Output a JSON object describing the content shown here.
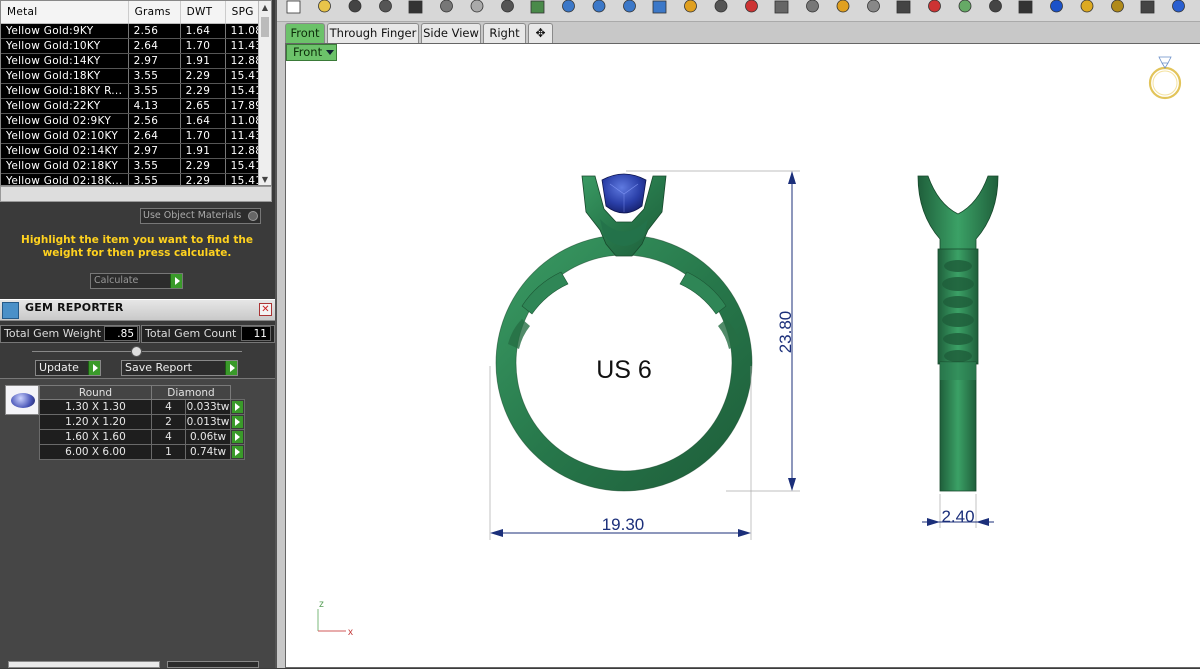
{
  "metal_table": {
    "headers": [
      "Metal",
      "Grams",
      "DWT",
      "SPG"
    ],
    "rows": [
      [
        "Yellow Gold:9KY",
        "2.56",
        "1.64",
        "11.08"
      ],
      [
        "Yellow Gold:10KY",
        "2.64",
        "1.70",
        "11.43"
      ],
      [
        "Yellow Gold:14KY",
        "2.97",
        "1.91",
        "12.88"
      ],
      [
        "Yellow Gold:18KY",
        "3.55",
        "2.29",
        "15.41"
      ],
      [
        "Yellow Gold:18KY R...",
        "3.55",
        "2.29",
        "15.41"
      ],
      [
        "Yellow Gold:22KY",
        "4.13",
        "2.65",
        "17.89"
      ],
      [
        "Yellow Gold 02:9KY",
        "2.56",
        "1.64",
        "11.08"
      ],
      [
        "Yellow Gold 02:10KY",
        "2.64",
        "1.70",
        "11.43"
      ],
      [
        "Yellow Gold 02:14KY",
        "2.97",
        "1.91",
        "12.88"
      ],
      [
        "Yellow Gold 02:18KY",
        "3.55",
        "2.29",
        "15.41"
      ],
      [
        "Yellow Gold 02:18K...",
        "3.55",
        "2.29",
        "15.41"
      ]
    ]
  },
  "metal_panel": {
    "use_object_materials": "Use Object Materials",
    "instruction": "Highlight the item you want to find the weight for then press calculate.",
    "calculate": "Calculate"
  },
  "gem_reporter": {
    "title": "GEM REPORTER",
    "total_weight_label": "Total Gem Weight",
    "total_weight": ".85",
    "total_count_label": "Total Gem Count",
    "total_count": "11",
    "update": "Update",
    "save_report": "Save Report",
    "shape_header": "Round",
    "material_header": "Diamond",
    "rows": [
      {
        "size": "1.30 X 1.30",
        "count": "4",
        "weight": "0.033tw"
      },
      {
        "size": "1.20 X 1.20",
        "count": "2",
        "weight": "0.013tw"
      },
      {
        "size": "1.60 X 1.60",
        "count": "4",
        "weight": "0.06tw"
      },
      {
        "size": "6.00 X 6.00",
        "count": "1",
        "weight": "0.74tw"
      }
    ]
  },
  "viewport": {
    "tabs": [
      "Front",
      "Through Finger",
      "Side View",
      "Right"
    ],
    "active_tab": "Front",
    "view_label": "Front",
    "ring_size": "US 6",
    "height_dim": "23.80",
    "width_dim": "19.30",
    "side_width_dim": "2.40",
    "axis_z": "z",
    "axis_x": "x",
    "colors": {
      "ring": "#2a7a4e",
      "gem": "#2a3fa8",
      "dimension": "#1b2f7a",
      "tab_active": "#6cc26a"
    }
  }
}
